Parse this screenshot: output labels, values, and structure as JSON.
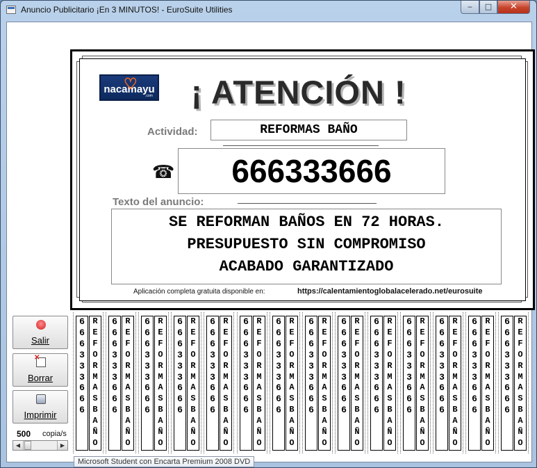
{
  "window": {
    "title": "Anuncio Publicitario  ¡En 3 MINUTOS! - EuroSuite Utilities",
    "minimize_glyph": "‒",
    "maximize_glyph": "□",
    "close_glyph": "✕"
  },
  "poster": {
    "logo_text": "nacamayu",
    "logo_sub": ".com",
    "headline": "¡ ATENCIÓN !",
    "activity_label": "Actividad:",
    "activity_value": "REFORMAS BAÑO",
    "phone_icon": "☎",
    "phone_value": "666333666",
    "ad_label": "Texto del anuncio:",
    "ad_lines": [
      "SE REFORMAN BAÑOS EN 72 HORAS.",
      "PRESUPUESTO SIN COMPROMISO",
      "ACABADO GARANTIZADO"
    ],
    "footer_text": "Aplicación completa gratuita disponible en:",
    "footer_url": "https://calentamientoglobalacelerado.net/eurosuite"
  },
  "controls": {
    "exit_label": "Salir",
    "clear_label": "Borrar",
    "print_label": "Imprimir",
    "copies_value": "500",
    "copies_unit": "copia/s"
  },
  "strips": {
    "count": 14,
    "phone_chars": [
      "6",
      "6",
      "6",
      "3",
      "3",
      "3",
      "6",
      "6",
      "6"
    ],
    "activity_chars": [
      "R",
      "E",
      "F",
      "O",
      "R",
      "M",
      "A",
      "S",
      "B",
      "A",
      "Ñ",
      "O"
    ]
  },
  "tooltip": "Microsoft Student con Encarta Premium 2008 DVD"
}
